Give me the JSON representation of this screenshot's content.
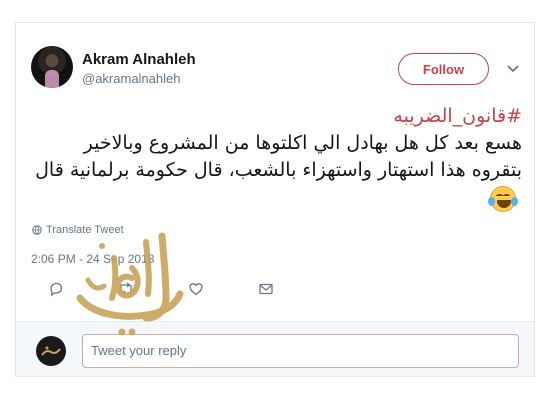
{
  "user": {
    "display_name": "Akram Alnahleh",
    "handle": "@akramalnahleh",
    "avatar_icon": "avatar"
  },
  "header": {
    "follow_label": "Follow",
    "menu_icon": "chevron-down-icon"
  },
  "tweet": {
    "hashtag": "#قانون_الضريبه",
    "lines": [
      "هسع بعد كل هل بهادل الي اكلتوها من المشروع وبالاخير",
      "بتقروه هذا استهتار واستهزاء بالشعب، قال حكومة برلمانية قال"
    ],
    "emoji": "face-with-tears-of-joy"
  },
  "translate": {
    "label": "Translate Tweet",
    "icon": "globe-icon"
  },
  "timestamp": "2:06 PM - 24 Sep 2018",
  "actions": {
    "reply_icon": "reply-icon",
    "retweet_icon": "retweet-icon",
    "like_icon": "heart-icon",
    "message_icon": "mail-icon"
  },
  "reply": {
    "placeholder": "Tweet your reply"
  },
  "watermark": {
    "text": "الوكيل",
    "color": "#c9a45c"
  },
  "colors": {
    "accent": "#c0464c",
    "muted": "#657786",
    "text": "#14171a"
  }
}
